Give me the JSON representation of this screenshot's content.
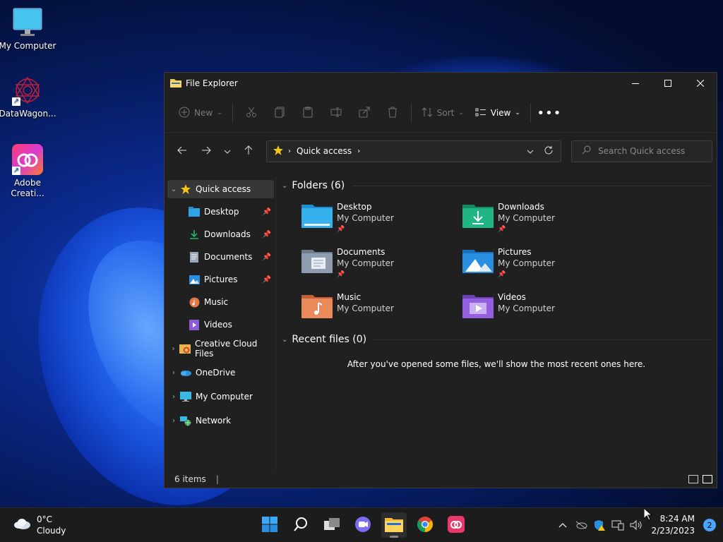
{
  "desktop": {
    "icons": [
      {
        "label": "My Computer",
        "icon": "monitor-icon"
      },
      {
        "label": "DataWagon...",
        "icon": "datawagon-icon"
      },
      {
        "label": "Adobe Creati...",
        "icon": "adobe-cc-icon"
      }
    ]
  },
  "window": {
    "title": "File Explorer",
    "commands": {
      "new": "New",
      "sort": "Sort",
      "view": "View"
    },
    "address": {
      "crumb": "Quick access"
    },
    "search": {
      "placeholder": "Search Quick access"
    },
    "sidebar": [
      {
        "label": "Quick access",
        "icon": "star-icon",
        "level": 0,
        "expanded": true,
        "selected": true
      },
      {
        "label": "Desktop",
        "icon": "desktop-folder-icon",
        "level": 1,
        "pinned": true
      },
      {
        "label": "Downloads",
        "icon": "downloads-icon",
        "level": 1,
        "pinned": true
      },
      {
        "label": "Documents",
        "icon": "documents-icon",
        "level": 1,
        "pinned": true
      },
      {
        "label": "Pictures",
        "icon": "pictures-icon",
        "level": 1,
        "pinned": true
      },
      {
        "label": "Music",
        "icon": "music-icon",
        "level": 1
      },
      {
        "label": "Videos",
        "icon": "videos-icon",
        "level": 1
      },
      {
        "label": "Creative Cloud Files",
        "icon": "creative-cloud-folder-icon",
        "level": 0
      },
      {
        "label": "OneDrive",
        "icon": "onedrive-icon",
        "level": 0
      },
      {
        "label": "My Computer",
        "icon": "computer-icon",
        "level": 0
      },
      {
        "label": "Network",
        "icon": "network-icon",
        "level": 0
      }
    ],
    "folders_header": "Folders (6)",
    "folders": [
      {
        "name": "Desktop",
        "location": "My Computer",
        "pinned": true,
        "color": "#2fa4e7"
      },
      {
        "name": "Downloads",
        "location": "My Computer",
        "pinned": true,
        "color": "#1aa57a"
      },
      {
        "name": "Documents",
        "location": "My Computer",
        "pinned": true,
        "color": "#7f8fa6"
      },
      {
        "name": "Pictures",
        "location": "My Computer",
        "pinned": true,
        "color": "#2a8fe0"
      },
      {
        "name": "Music",
        "location": "My Computer",
        "pinned": false,
        "color": "#e0784a"
      },
      {
        "name": "Videos",
        "location": "My Computer",
        "pinned": false,
        "color": "#8e5bd6"
      }
    ],
    "recent_header": "Recent files (0)",
    "recent_empty": "After you've opened some files, we'll show the most recent ones here.",
    "status": "6 items"
  },
  "taskbar": {
    "weather": {
      "temp": "0°C",
      "condition": "Cloudy"
    },
    "time": "8:24 AM",
    "date": "2/23/2023",
    "notifications": "2"
  }
}
